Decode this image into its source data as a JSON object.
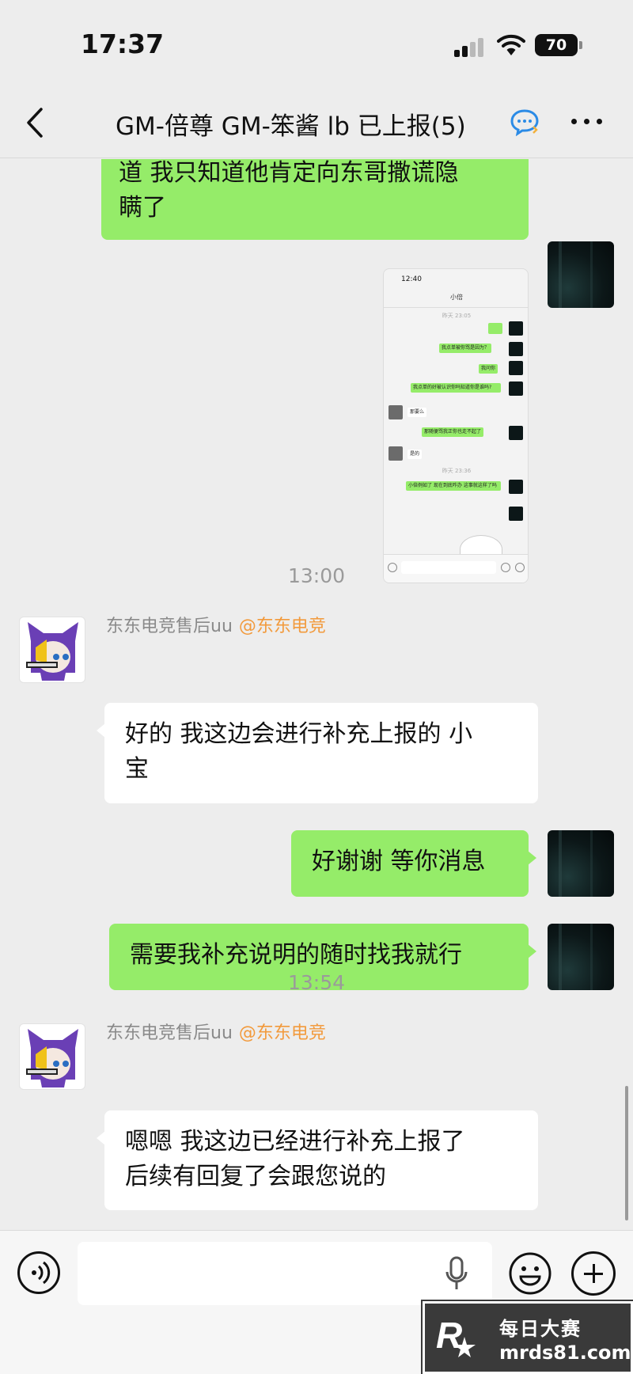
{
  "status_bar": {
    "time": "17:37",
    "battery": "70"
  },
  "nav": {
    "title": "GM-倍尊 GM-笨酱 lb 已上报(5)"
  },
  "messages": {
    "m1_text": "道 我只知道他肯定向东哥撒谎隐\n瞒了",
    "ts1": "13:00",
    "m3_sender": "东东电竞售后uu",
    "m3_mention": "@东东电竞",
    "m3_text": "好的 我这边会进行补充上报的 小\n宝",
    "m4_text": "好谢谢 等你消息",
    "m5_text": "需要我补充说明的随时找我就行",
    "ts2": "13:54",
    "m6_sender": "东东电竞售后uu",
    "m6_mention": "@东东电竞",
    "m6_text": "嗯嗯 我这边已经进行补充上报了\n后续有回复了会跟您说的"
  },
  "screenshot": {
    "time": "12:40",
    "title": "小倍",
    "stamp1": "昨天 23:05",
    "stamp2": "昨天 23:36",
    "bubbles": [
      "我点单被你骂是因为？",
      "我问你",
      "我点单的好被认识你吗知道你是谁吗?",
      "那要么",
      "那随便骂我正你也走不起了",
      "是的",
      "小倍例如了 现在到底咋办 这事就这样了吗"
    ]
  },
  "input": {
    "placeholder": ""
  },
  "watermark": {
    "line1": "每日大赛",
    "line2": "mrds81.com"
  },
  "colors": {
    "bubble_green": "#95ec69",
    "bubble_white": "#ffffff",
    "mention": "#f29a3c",
    "background": "#ededed"
  },
  "icons": [
    "back-icon",
    "chat-bubble-icon",
    "more-icon",
    "voice-icon",
    "mic-icon",
    "emoji-icon",
    "plus-icon"
  ]
}
